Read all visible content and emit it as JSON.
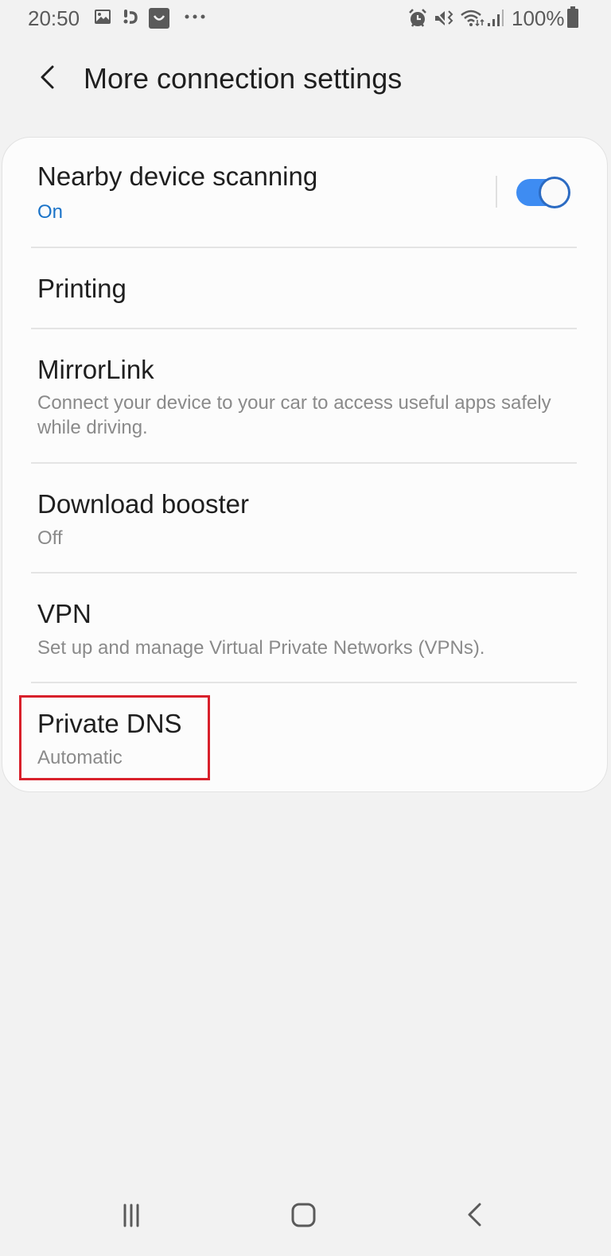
{
  "status_bar": {
    "time": "20:50",
    "left_icons": [
      "gallery-icon",
      "missed-call-icon",
      "shop-bag-icon",
      "more-dots-icon"
    ],
    "right_icons": [
      "alarm-icon",
      "vibrate-mute-icon",
      "wifi-icon",
      "signal-icon"
    ],
    "battery": "100%"
  },
  "header": {
    "title": "More connection settings",
    "back_icon": "back-chevron-icon"
  },
  "settings": [
    {
      "title": "Nearby device scanning",
      "subtitle": "On",
      "has_toggle": true,
      "toggle_on": true
    },
    {
      "title": "Printing",
      "subtitle": ""
    },
    {
      "title": "MirrorLink",
      "subtitle": "Connect your device to your car to access useful apps safely while driving."
    },
    {
      "title": "Download booster",
      "subtitle": "Off"
    },
    {
      "title": "VPN",
      "subtitle": "Set up and manage Virtual Private Networks (VPNs)."
    },
    {
      "title": "Private DNS",
      "subtitle": "Automatic",
      "highlighted": true
    }
  ],
  "colors": {
    "accent": "#3e8cf2",
    "on_text": "#1a73c8",
    "highlight": "#d8202b"
  },
  "navbar": {
    "buttons": [
      "recents-icon",
      "home-icon",
      "back-icon"
    ]
  }
}
